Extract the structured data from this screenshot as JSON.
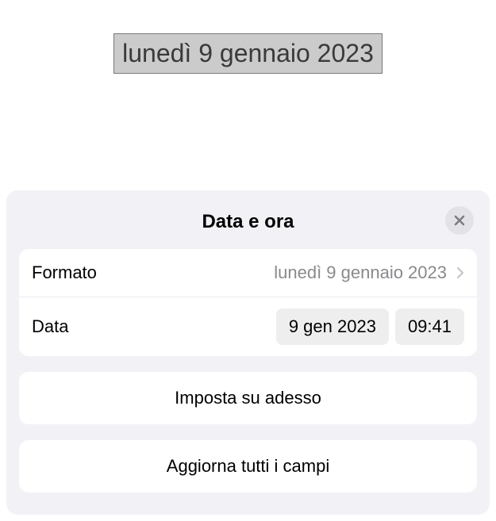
{
  "top_field": {
    "value": "lunedì 9 gennaio 2023"
  },
  "panel": {
    "title": "Data e ora",
    "format_row": {
      "label": "Formato",
      "value": "lunedì 9 gennaio 2023"
    },
    "data_row": {
      "label": "Data",
      "date_value": "9 gen 2023",
      "time_value": "09:41"
    },
    "set_now_button": "Imposta su adesso",
    "update_all_button": "Aggiorna tutti i campi"
  }
}
